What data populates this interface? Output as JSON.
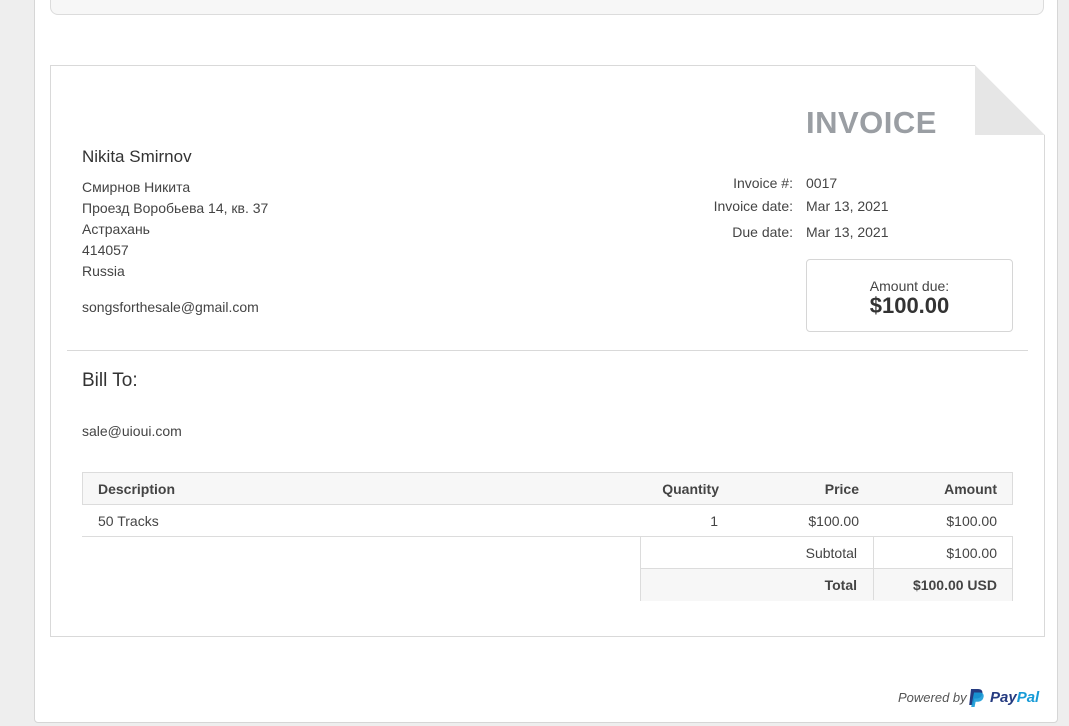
{
  "invoice": {
    "title": "INVOICE",
    "merchant": {
      "name": "Nikita Smirnov",
      "address_lines": [
        "Смирнов Никита",
        "Проезд Воробьева 14, кв. 37",
        "Астрахань",
        "414057",
        "Russia"
      ],
      "email": "songsforthesale@gmail.com"
    },
    "meta": {
      "number_label": "Invoice #:",
      "number_value": "0017",
      "date_label": "Invoice date:",
      "date_value": "Mar 13, 2021",
      "due_label": "Due date:",
      "due_value": "Mar 13, 2021"
    },
    "amount_due": {
      "label": "Amount due:",
      "value": "$100.00"
    },
    "bill_to": {
      "heading": "Bill To:",
      "email": "sale@uioui.com"
    },
    "items": {
      "headers": {
        "description": "Description",
        "quantity": "Quantity",
        "price": "Price",
        "amount": "Amount"
      },
      "rows": [
        {
          "description": "50 Tracks",
          "quantity": "1",
          "price": "$100.00",
          "amount": "$100.00"
        }
      ]
    },
    "totals": {
      "subtotal_label": "Subtotal",
      "subtotal_value": "$100.00",
      "total_label": "Total",
      "total_value": "$100.00 USD"
    }
  },
  "footer": {
    "powered_by": "Powered by",
    "brand_part1": "Pay",
    "brand_part2": "Pal",
    "icon": "paypal-icon"
  },
  "colors": {
    "title_gray": "#9a9ea3",
    "paypal_dark": "#253b80",
    "paypal_light": "#179bd7"
  }
}
